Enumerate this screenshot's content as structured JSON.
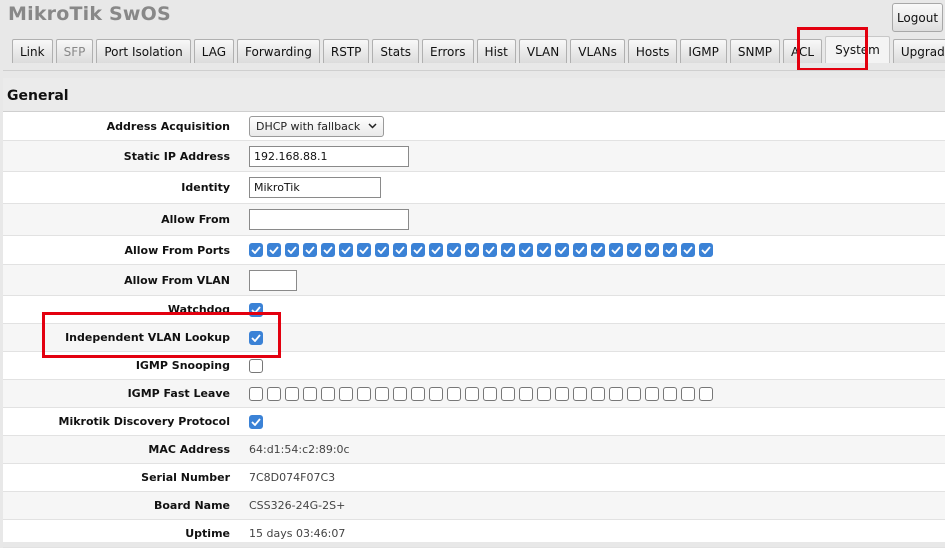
{
  "app": {
    "title": "MikroTik SwOS",
    "logout_label": "Logout"
  },
  "tabs": [
    {
      "label": "Link"
    },
    {
      "label": "SFP"
    },
    {
      "label": "Port Isolation"
    },
    {
      "label": "LAG"
    },
    {
      "label": "Forwarding"
    },
    {
      "label": "RSTP"
    },
    {
      "label": "Stats"
    },
    {
      "label": "Errors"
    },
    {
      "label": "Hist"
    },
    {
      "label": "VLAN"
    },
    {
      "label": "VLANs"
    },
    {
      "label": "Hosts"
    },
    {
      "label": "IGMP"
    },
    {
      "label": "SNMP"
    },
    {
      "label": "ACL"
    },
    {
      "label": "System"
    },
    {
      "label": "Upgrade"
    }
  ],
  "active_tab": "System",
  "disabled_tabs": [
    "SFP"
  ],
  "section": {
    "title": "General"
  },
  "fields": {
    "address_acquisition": {
      "label": "Address Acquisition",
      "value": "DHCP with fallback"
    },
    "static_ip": {
      "label": "Static IP Address",
      "value": "192.168.88.1"
    },
    "identity": {
      "label": "Identity",
      "value": "MikroTik"
    },
    "allow_from": {
      "label": "Allow From",
      "value": ""
    },
    "allow_from_ports": {
      "label": "Allow From Ports",
      "checked": [
        true,
        true,
        true,
        true,
        true,
        true,
        true,
        true,
        true,
        true,
        true,
        true,
        true,
        true,
        true,
        true,
        true,
        true,
        true,
        true,
        true,
        true,
        true,
        true,
        true,
        true
      ]
    },
    "allow_from_vlan": {
      "label": "Allow From VLAN",
      "value": ""
    },
    "watchdog": {
      "label": "Watchdog",
      "checked": true
    },
    "independent_vlan_lookup": {
      "label": "Independent VLAN Lookup",
      "checked": true
    },
    "igmp_snooping": {
      "label": "IGMP Snooping",
      "checked": false
    },
    "igmp_fast_leave": {
      "label": "IGMP Fast Leave",
      "checked": [
        false,
        false,
        false,
        false,
        false,
        false,
        false,
        false,
        false,
        false,
        false,
        false,
        false,
        false,
        false,
        false,
        false,
        false,
        false,
        false,
        false,
        false,
        false,
        false,
        false,
        false
      ]
    },
    "mikrotik_discovery": {
      "label": "Mikrotik Discovery Protocol",
      "checked": true
    },
    "mac_address": {
      "label": "MAC Address",
      "value": "64:d1:54:c2:89:0c"
    },
    "serial_number": {
      "label": "Serial Number",
      "value": "7C8D074F07C3"
    },
    "board_name": {
      "label": "Board Name",
      "value": "CSS326-24G-2S+"
    },
    "uptime": {
      "label": "Uptime",
      "value": "15 days 03:46:07"
    }
  },
  "colors": {
    "highlight": "#e3000f",
    "checkbox_on": "#3b82d6"
  }
}
